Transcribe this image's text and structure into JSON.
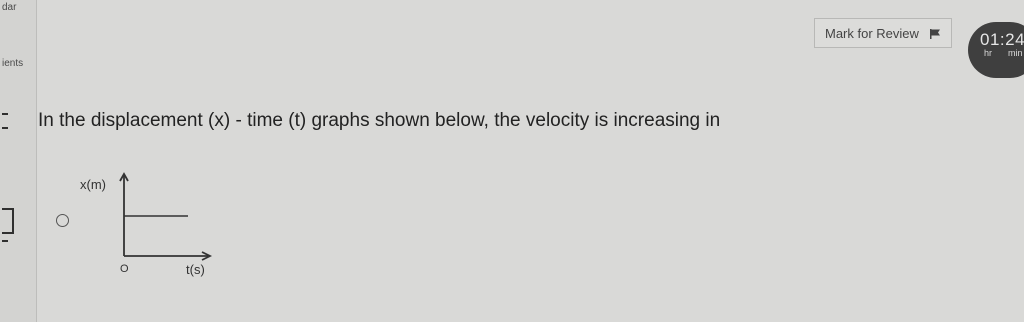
{
  "left_rail": {
    "top_text": "dar",
    "middle_text": "ients"
  },
  "header": {
    "mark_for_review_label": "Mark for Review",
    "timer": {
      "value": "01:24",
      "unit_hours": "hr",
      "unit_minutes": "min"
    }
  },
  "question": {
    "text": "In the displacement (x) - time (t) graphs shown below, the velocity is increasing in"
  },
  "options": [
    {
      "graph": {
        "y_axis_label": "x(m)",
        "x_axis_label": "t(s)",
        "origin_label": "O"
      }
    }
  ],
  "colors": {
    "background": "#d9d9d7",
    "timer_bg": "#3f3f3f",
    "text": "#222222"
  }
}
